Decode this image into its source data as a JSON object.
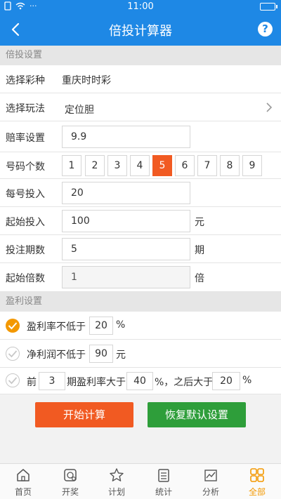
{
  "status_bar": {
    "time": "11:00",
    "left_dots": "···",
    "battery_label": ""
  },
  "nav": {
    "title": "倍投计算器",
    "help": "?"
  },
  "section1": {
    "title": "倍投设置"
  },
  "lottery": {
    "label": "选择彩种",
    "value": "重庆时时彩"
  },
  "play": {
    "label": "选择玩法",
    "value": "定位胆"
  },
  "odds": {
    "label": "赔率设置",
    "value": "9.9"
  },
  "numbers": {
    "label": "号码个数",
    "options": [
      "1",
      "2",
      "3",
      "4",
      "5",
      "6",
      "7",
      "8",
      "9"
    ],
    "selected": "5"
  },
  "per_bet": {
    "label": "每号投入",
    "value": "20"
  },
  "start_bet": {
    "label": "起始投入",
    "value": "100",
    "unit": "元"
  },
  "periods": {
    "label": "投注期数",
    "value": "5",
    "unit": "期"
  },
  "start_multiple": {
    "label": "起始倍数",
    "value": "1",
    "unit": "倍"
  },
  "section2": {
    "title": "盈利设置"
  },
  "profit_rate": {
    "prefix": "盈利率不低于",
    "value": "20",
    "suffix": "%"
  },
  "net_profit": {
    "prefix": "净利润不低于",
    "value": "90",
    "suffix": "元"
  },
  "staged": {
    "prefix": "前",
    "periods": "3",
    "mid": "期盈利率大于",
    "rate1": "40",
    "mid2": "%，之后大于",
    "rate2": "20",
    "suffix": "%"
  },
  "buttons": {
    "start": "开始计算",
    "reset": "恢复默认设置"
  },
  "tabs": [
    {
      "label": "首页",
      "icon": "home-icon"
    },
    {
      "label": "开奖",
      "icon": "lottery-draw-icon"
    },
    {
      "label": "计划",
      "icon": "star-icon"
    },
    {
      "label": "统计",
      "icon": "list-icon"
    },
    {
      "label": "分析",
      "icon": "analysis-icon"
    },
    {
      "label": "全部",
      "icon": "grid-icon"
    }
  ],
  "colors": {
    "primary": "#1e88e5",
    "accent_orange": "#f15a22",
    "green": "#2e9e3a",
    "check_on": "#f39800"
  }
}
